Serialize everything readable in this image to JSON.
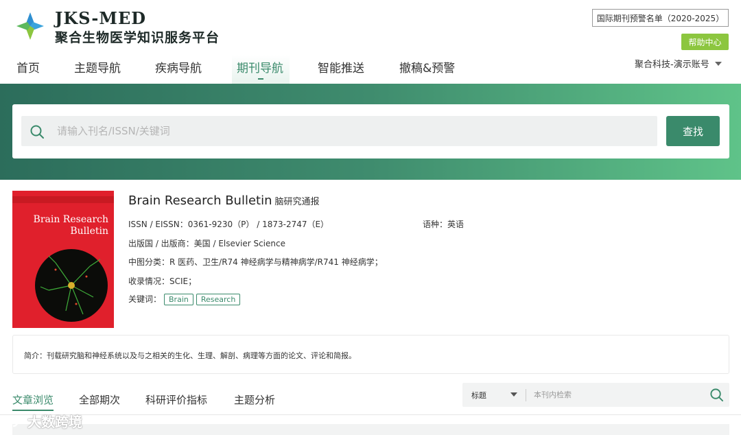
{
  "header": {
    "brand_name": "JKS-MED",
    "brand_sub": "聚合生物医学知识服务平台",
    "warning_list": "国际期刊预警名单（2020-2025）",
    "help": "帮助中心",
    "account": "聚合科技-演示账号"
  },
  "nav": {
    "items": [
      "首页",
      "主题导航",
      "疾病导航",
      "期刊导航",
      "智能推送",
      "撤稿&预警"
    ],
    "active": "期刊导航"
  },
  "search": {
    "placeholder": "请输入刊名/ISSN/关键词",
    "button": "查找"
  },
  "journal": {
    "cover_title": "Brain Research Bulletin",
    "title": "Brain Research Bulletin",
    "title_cn": "脑研究通报",
    "issn": "ISSN / EISSN：0361-9230（P） / 1873-2747（E）",
    "language": "语种：英语",
    "publisher": "出版国 / 出版商：美国 / Elsevier Science",
    "classification": "中图分类：R 医药、卫生/R74 神经病学与精神病学/R741 神经病学；",
    "indexed": "收录情况：SCIE；",
    "keywords_label": "关键词：",
    "keywords": [
      "Brain",
      "Research"
    ],
    "intro": "简介：刊载研究脑和神经系统以及与之相关的生化、生理、解剖、病理等方面的论文、评论和简报。"
  },
  "tabs": {
    "items": [
      "文章浏览",
      "全部期次",
      "科研评价指标",
      "主题分析"
    ],
    "active": "文章浏览"
  },
  "inner_search": {
    "field": "标题",
    "placeholder": "本刊内检索"
  },
  "watermark": "大数跨境",
  "colors": {
    "primary": "#3a8a6b",
    "help_green": "#8cc63f",
    "cover_red": "#e0202c"
  }
}
